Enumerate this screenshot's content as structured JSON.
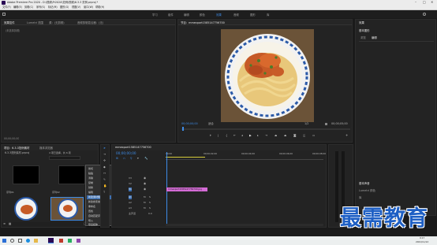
{
  "titlebar": {
    "title": "Adobe Premiere Pro 2020 - D:\\视频\\Pr2020\\范例\\视频\\6.3.3 范例.prproj *"
  },
  "menu": [
    "文件(F)",
    "编辑(E)",
    "剪辑(C)",
    "序列(S)",
    "标记(M)",
    "图形(G)",
    "视图(V)",
    "窗口(W)",
    "帮助(H)"
  ],
  "workspaces": [
    "学习",
    "组件",
    "编辑",
    "颜色",
    "效果",
    "音频",
    "图形",
    "库"
  ],
  "source_panel": {
    "tabs": [
      "效果控件",
      "Lumetri 范围",
      "源：(无剪辑)",
      "音频剪辑混合器：(无)"
    ],
    "empty_label": "(未选择剪辑)",
    "timecode": "00;00;00;00"
  },
  "program_monitor": {
    "tab": "节目：mmexport1585147756700",
    "timecode_left": "00;00;00;00",
    "fit": "适合",
    "ratio": "1/2",
    "timecode_right": "00;00;05;00"
  },
  "right_panel": {
    "title": "效果",
    "tabs": [
      "预设",
      "Lumetri 预设",
      "音频效果",
      "音频过渡",
      "视频效果",
      "视频过渡"
    ],
    "section": "基本图形",
    "sub_tabs": [
      "浏览",
      "编辑"
    ],
    "lower_title": "基本声音",
    "lower_items": [
      "Lumetri 颜色",
      "库"
    ]
  },
  "project_panel": {
    "tabs": [
      "项目：6.3.3范例素材",
      "媒体浏览器"
    ],
    "file_name": "6.3.3范例素材.prproj",
    "item_count": "4 项已选择，共 6 项",
    "items": [
      {
        "label": "序列01",
        "duration": "5:00"
      },
      {
        "label": "序列02",
        "duration": ""
      },
      {
        "label": "mmexport1585147756700",
        "duration": "5:00"
      },
      {
        "label": "mmexport1585147756700",
        "duration": ""
      }
    ]
  },
  "context_menu": [
    "剪切",
    "粘贴",
    "清除",
    "复制",
    "替换",
    "编辑",
    "新建素材箱",
    "新建搜索素材箱",
    "重命名",
    "查找",
    "自动匹配序列",
    "导入",
    "导出媒体"
  ],
  "timeline": {
    "tab": "mmexport1585147756700",
    "timecode": "00;00;00;00",
    "ruler": [
      "00;00",
      "00;00;02;00",
      "00;00;04;00",
      "00;00;06;00",
      "00;00;08;00"
    ],
    "video_tracks": [
      "V3",
      "V2",
      "V1"
    ],
    "audio_tracks": [
      "A1",
      "A2",
      "A3"
    ],
    "master": "主声道",
    "master_value": "0.0",
    "clip_label": "mmexport1585147756700.jpg"
  },
  "taskbar": {
    "time": "9:17",
    "date": "2021/11/12"
  },
  "watermark": "最需教育",
  "colors": {
    "accent": "#3d8be6",
    "clip": "#d46bd6",
    "bg": "#1a1a1a",
    "panel": "#232323",
    "watermark": "#1e5fc4"
  }
}
